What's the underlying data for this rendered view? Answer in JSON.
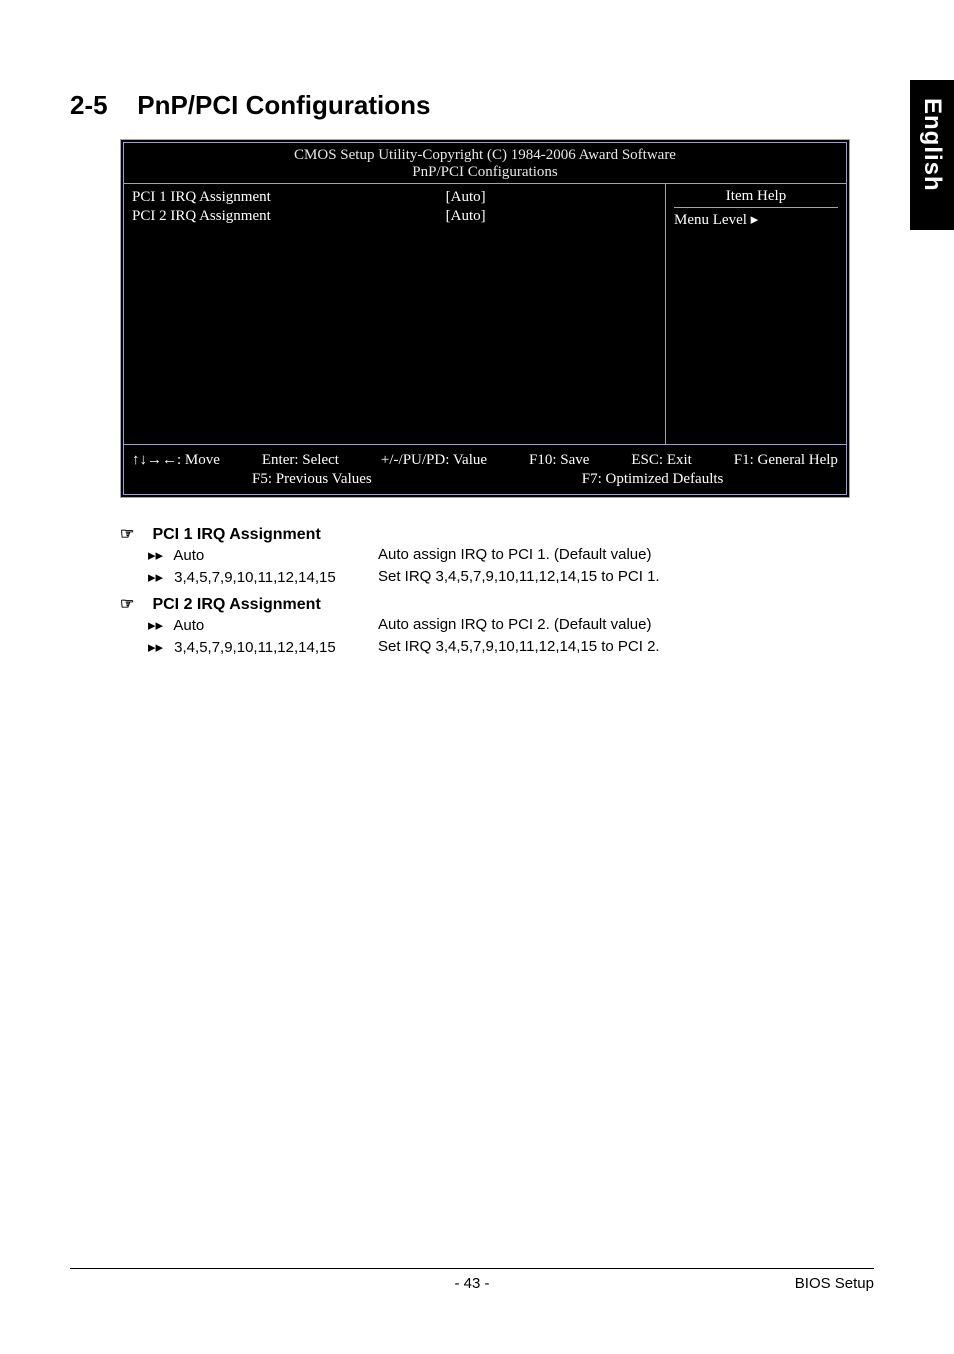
{
  "language_tab": "English",
  "section": {
    "number": "2-5",
    "title": "PnP/PCI Configurations"
  },
  "bios": {
    "title_line1": "CMOS Setup Utility-Copyright (C) 1984-2006 Award Software",
    "title_line2": "PnP/PCI Configurations",
    "rows": [
      {
        "label": "PCI 1 IRQ Assignment",
        "value": "[Auto]"
      },
      {
        "label": "PCI 2 IRQ Assignment",
        "value": "[Auto]"
      }
    ],
    "help_panel": {
      "header": "Item Help",
      "menu_level_label": "Menu Level",
      "menu_level_arrow": "▸"
    },
    "footer": {
      "move": "↑↓→←: Move",
      "enter": "Enter: Select",
      "pupd": "+/-/PU/PD: Value",
      "f10": "F10: Save",
      "esc": "ESC: Exit",
      "f1": "F1: General Help",
      "f5": "F5: Previous Values",
      "f7": "F7: Optimized Defaults"
    }
  },
  "help": [
    {
      "heading": "PCI 1 IRQ Assignment",
      "items": [
        {
          "option": "Auto",
          "desc": "Auto assign IRQ to PCI 1. (Default value)"
        },
        {
          "option": "3,4,5,7,9,10,11,12,14,15",
          "desc": "Set IRQ 3,4,5,7,9,10,11,12,14,15 to PCI 1."
        }
      ]
    },
    {
      "heading": "PCI 2 IRQ Assignment",
      "items": [
        {
          "option": "Auto",
          "desc": "Auto assign IRQ to PCI 2. (Default value)"
        },
        {
          "option": "3,4,5,7,9,10,11,12,14,15",
          "desc": "Set IRQ 3,4,5,7,9,10,11,12,14,15 to PCI 2."
        }
      ]
    }
  ],
  "footer": {
    "page": "- 43 -",
    "right": "BIOS Setup"
  },
  "glyphs": {
    "hand": "☞",
    "double_arrow": "▸▸"
  }
}
